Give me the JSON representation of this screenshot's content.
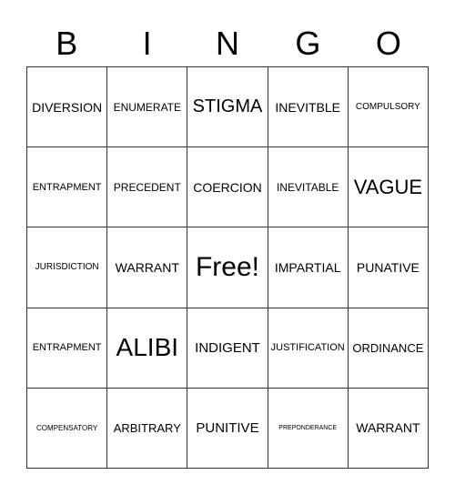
{
  "header": [
    "B",
    "I",
    "N",
    "G",
    "O"
  ],
  "cells": [
    [
      "DIVERSION",
      "ENUMERATE",
      "STIGMA",
      "INEVITBLE",
      "COMPULSORY"
    ],
    [
      "ENTRAPMENT",
      "PRECEDENT",
      "COERCION",
      "INEVITABLE",
      "VAGUE"
    ],
    [
      "JURISDICTION",
      "WARRANT",
      "Free!",
      "IMPARTIAL",
      "PUNATIVE"
    ],
    [
      "ENTRAPMENT",
      "ALIBI",
      "INDIGENT",
      "JUSTIFICATION",
      "ORDINANCE"
    ],
    [
      "COMPENSATORY",
      "ARBITRARY",
      "PUNITIVE",
      "PREPONDERANCE",
      "WARRANT"
    ]
  ]
}
